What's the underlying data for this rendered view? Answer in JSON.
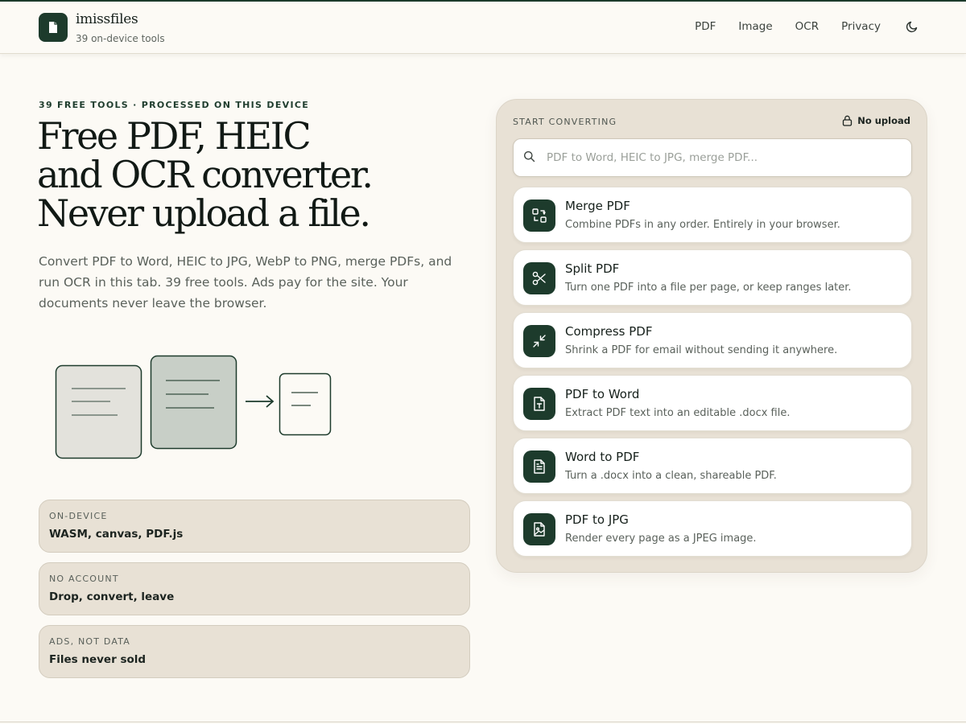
{
  "brand": {
    "name": "imissfiles",
    "subtitle": "39 on-device tools"
  },
  "nav": {
    "items": [
      "PDF",
      "Image",
      "OCR",
      "Privacy"
    ]
  },
  "hero": {
    "eyebrow": "39 FREE TOOLS · PROCESSED ON THIS DEVICE",
    "title_lines": [
      "Free PDF, HEIC",
      "and OCR converter.",
      "Never upload a file."
    ],
    "lead": "Convert PDF to Word, HEIC to JPG, WebP to PNG, merge PDFs, and run OCR in this tab. 39 free tools. Ads pay for the site. Your documents never leave the browser."
  },
  "features": [
    {
      "key": "ON-DEVICE",
      "value": "WASM, canvas, PDF.js"
    },
    {
      "key": "NO ACCOUNT",
      "value": "Drop, convert, leave"
    },
    {
      "key": "ADS, NOT DATA",
      "value": "Files never sold"
    }
  ],
  "panel": {
    "label": "START CONVERTING",
    "badge": "No upload",
    "search_placeholder": "PDF to Word, HEIC to JPG, merge PDF...",
    "tools": [
      {
        "title": "Merge PDF",
        "desc": "Combine PDFs in any order. Entirely in your browser.",
        "icon": "merge-icon"
      },
      {
        "title": "Split PDF",
        "desc": "Turn one PDF into a file per page, or keep ranges later.",
        "icon": "scissors-icon"
      },
      {
        "title": "Compress PDF",
        "desc": "Shrink a PDF for email without sending it anywhere.",
        "icon": "compress-icon"
      },
      {
        "title": "PDF to Word",
        "desc": "Extract PDF text into an editable .docx file.",
        "icon": "file-text-t-icon"
      },
      {
        "title": "Word to PDF",
        "desc": "Turn a .docx into a clean, shareable PDF.",
        "icon": "file-lines-icon"
      },
      {
        "title": "PDF to JPG",
        "desc": "Render every page as a JPEG image.",
        "icon": "file-image-icon"
      }
    ]
  },
  "colors": {
    "accent": "#1d3b2c",
    "background": "#fcfaf5",
    "panel": "#e8e1d5",
    "muted_text": "#5a615b"
  }
}
